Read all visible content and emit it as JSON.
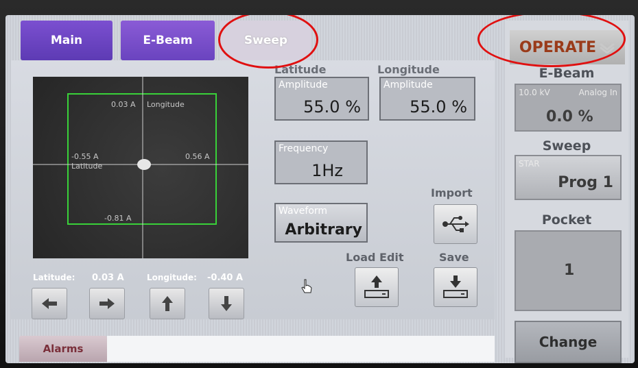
{
  "tabs": {
    "main": "Main",
    "ebeam": "E-Beam",
    "sweep": "Sweep"
  },
  "header": {
    "mode": "OPERATE"
  },
  "plot": {
    "longitude_top": "0.03 A",
    "longitude_label": "Longitude",
    "left_value": "-0.55 A",
    "latitude_label": "Latitude",
    "right_value": "0.56 A",
    "bottom_value": "-0.81 A"
  },
  "readouts": {
    "latitude_label": "Latitude:",
    "latitude_value": "0.03 A",
    "longitude_label": "Longitude:",
    "longitude_value": "-0.40 A"
  },
  "fields": {
    "latitude_head": "Latitude",
    "longitude_head": "Longitude",
    "lat_amp_label": "Amplitude",
    "lat_amp_value": "55.0 %",
    "lon_amp_label": "Amplitude",
    "lon_amp_value": "55.0 %",
    "freq_label": "Frequency",
    "freq_value": "1Hz",
    "waveform_label": "Waveform",
    "waveform_value": "Arbitrary"
  },
  "buttons": {
    "import": "Import",
    "load_edit": "Load Edit",
    "save": "Save",
    "alarms": "Alarms"
  },
  "sidebar": {
    "ebeam_title": "E-Beam",
    "ebeam_kv": "10.0 kV",
    "ebeam_mode": "Analog In",
    "ebeam_value": "0.0 %",
    "sweep_title": "Sweep",
    "sweep_type": "STAR",
    "sweep_prog": "Prog 1",
    "pocket_title": "Pocket",
    "pocket_value": "1",
    "change": "Change"
  }
}
